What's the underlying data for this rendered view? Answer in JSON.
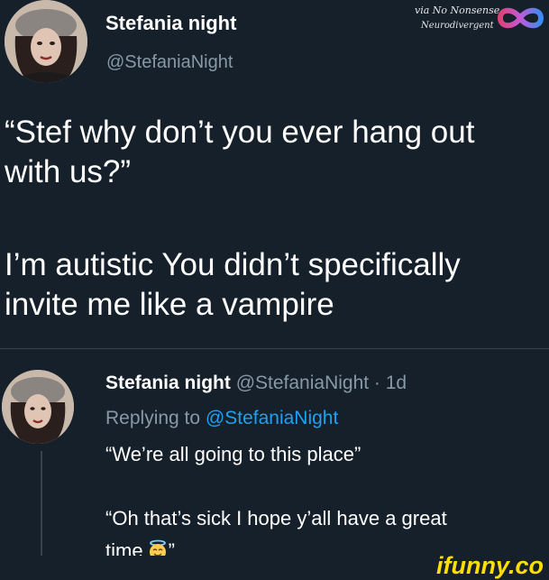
{
  "watermark": {
    "line1": "via No Nonsense",
    "line2": "Neurodivergent",
    "logo_icon": "infinity-icon"
  },
  "main_tweet": {
    "display_name": "Stefania night",
    "handle": "@StefaniaNight",
    "text_lines": [
      "“Stef why don’t you ever hang out",
      "with us?”",
      "I’m autistic You didn’t specifically",
      "invite me like a vampire"
    ]
  },
  "reply": {
    "display_name": "Stefania night",
    "meta": "@StefaniaNight · 1d",
    "replying_prefix": "Replying to ",
    "replying_mention": "@StefaniaNight",
    "text_lines": [
      "“We’re all going to this place”",
      "“Oh that’s sick I hope y’all have a great",
      "time",
      "”"
    ],
    "emoji_icon": "smiling-face-with-halo-icon"
  },
  "footer": {
    "brand": "ifunny.co"
  },
  "colors": {
    "background": "#15202b",
    "muted": "#8899a6",
    "link": "#1da1f2",
    "brand": "#ffde00"
  }
}
